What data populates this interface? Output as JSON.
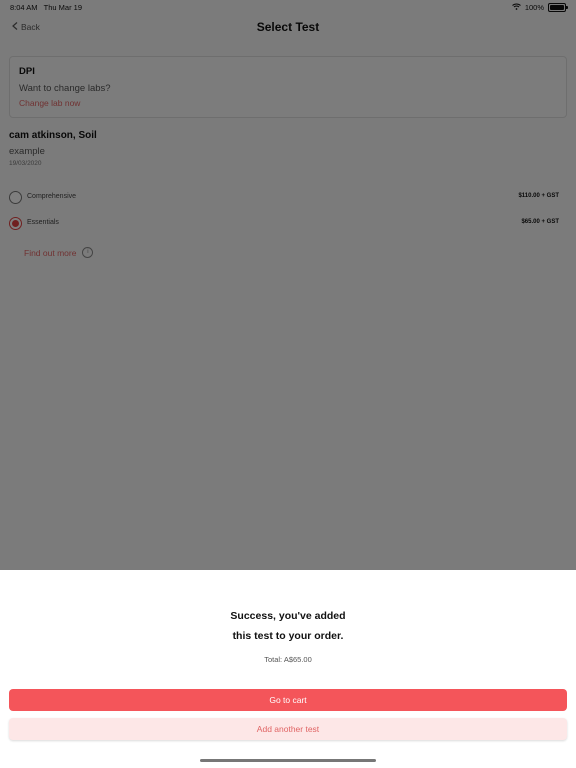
{
  "status_bar": {
    "time": "8:04 AM",
    "date": "Thu Mar 19",
    "battery": "100%"
  },
  "nav": {
    "back_label": "Back",
    "title": "Select Test"
  },
  "lab": {
    "name": "DPI",
    "question": "Want to change labs?",
    "change_link": "Change lab now"
  },
  "sample": {
    "title": "cam atkinson, Soil",
    "subtitle": "example",
    "date": "19/03/2020"
  },
  "options": [
    {
      "label": "Comprehensive",
      "price": "$110.00 + GST",
      "selected": false
    },
    {
      "label": "Essentials",
      "price": "$65.00 + GST",
      "selected": true
    }
  ],
  "find_out_more": "Find out more",
  "sheet": {
    "line1": "Success, you've added",
    "line2": "this test to your order.",
    "total": "Total: A$65.00",
    "primary_button": "Go to cart",
    "secondary_button": "Add another test"
  },
  "colors": {
    "accent": "#f4555a",
    "accent_light": "#fde7e7",
    "link": "#e06464"
  }
}
